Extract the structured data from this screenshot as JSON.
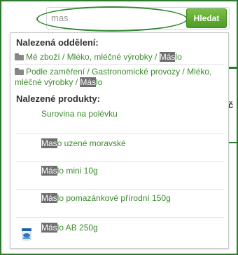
{
  "search": {
    "value": "mas",
    "button_label": "Hledat"
  },
  "departments": {
    "title": "Nalezená oddělení:",
    "items": [
      {
        "pre": "Mé zboží / Mléko, mléčné výrobky / ",
        "hl": "Más",
        "post": "lo"
      },
      {
        "pre_line1": "Podle zaměření / Gastronomické provozy / Mléko,",
        "pre_line2": "mléčné výrobky / ",
        "hl": "Más",
        "post": "lo"
      }
    ]
  },
  "products": {
    "title": "Nalezené produkty:",
    "items": [
      {
        "hl": "",
        "rest": "Surovina na polévku"
      },
      {
        "hl": "Mas",
        "rest": "o uzené moravské"
      },
      {
        "hl": "Más",
        "rest": "lo mini 10g"
      },
      {
        "hl": "Más",
        "rest": "lo pomazánkové přírodní 150g"
      },
      {
        "hl": "Más",
        "rest": "lo AB 250g"
      }
    ]
  },
  "side_text": "č",
  "colors": {
    "accent_green": "#3c8a2e",
    "button_green": "#5aa62c",
    "highlight_bg": "#6e6e6e"
  }
}
